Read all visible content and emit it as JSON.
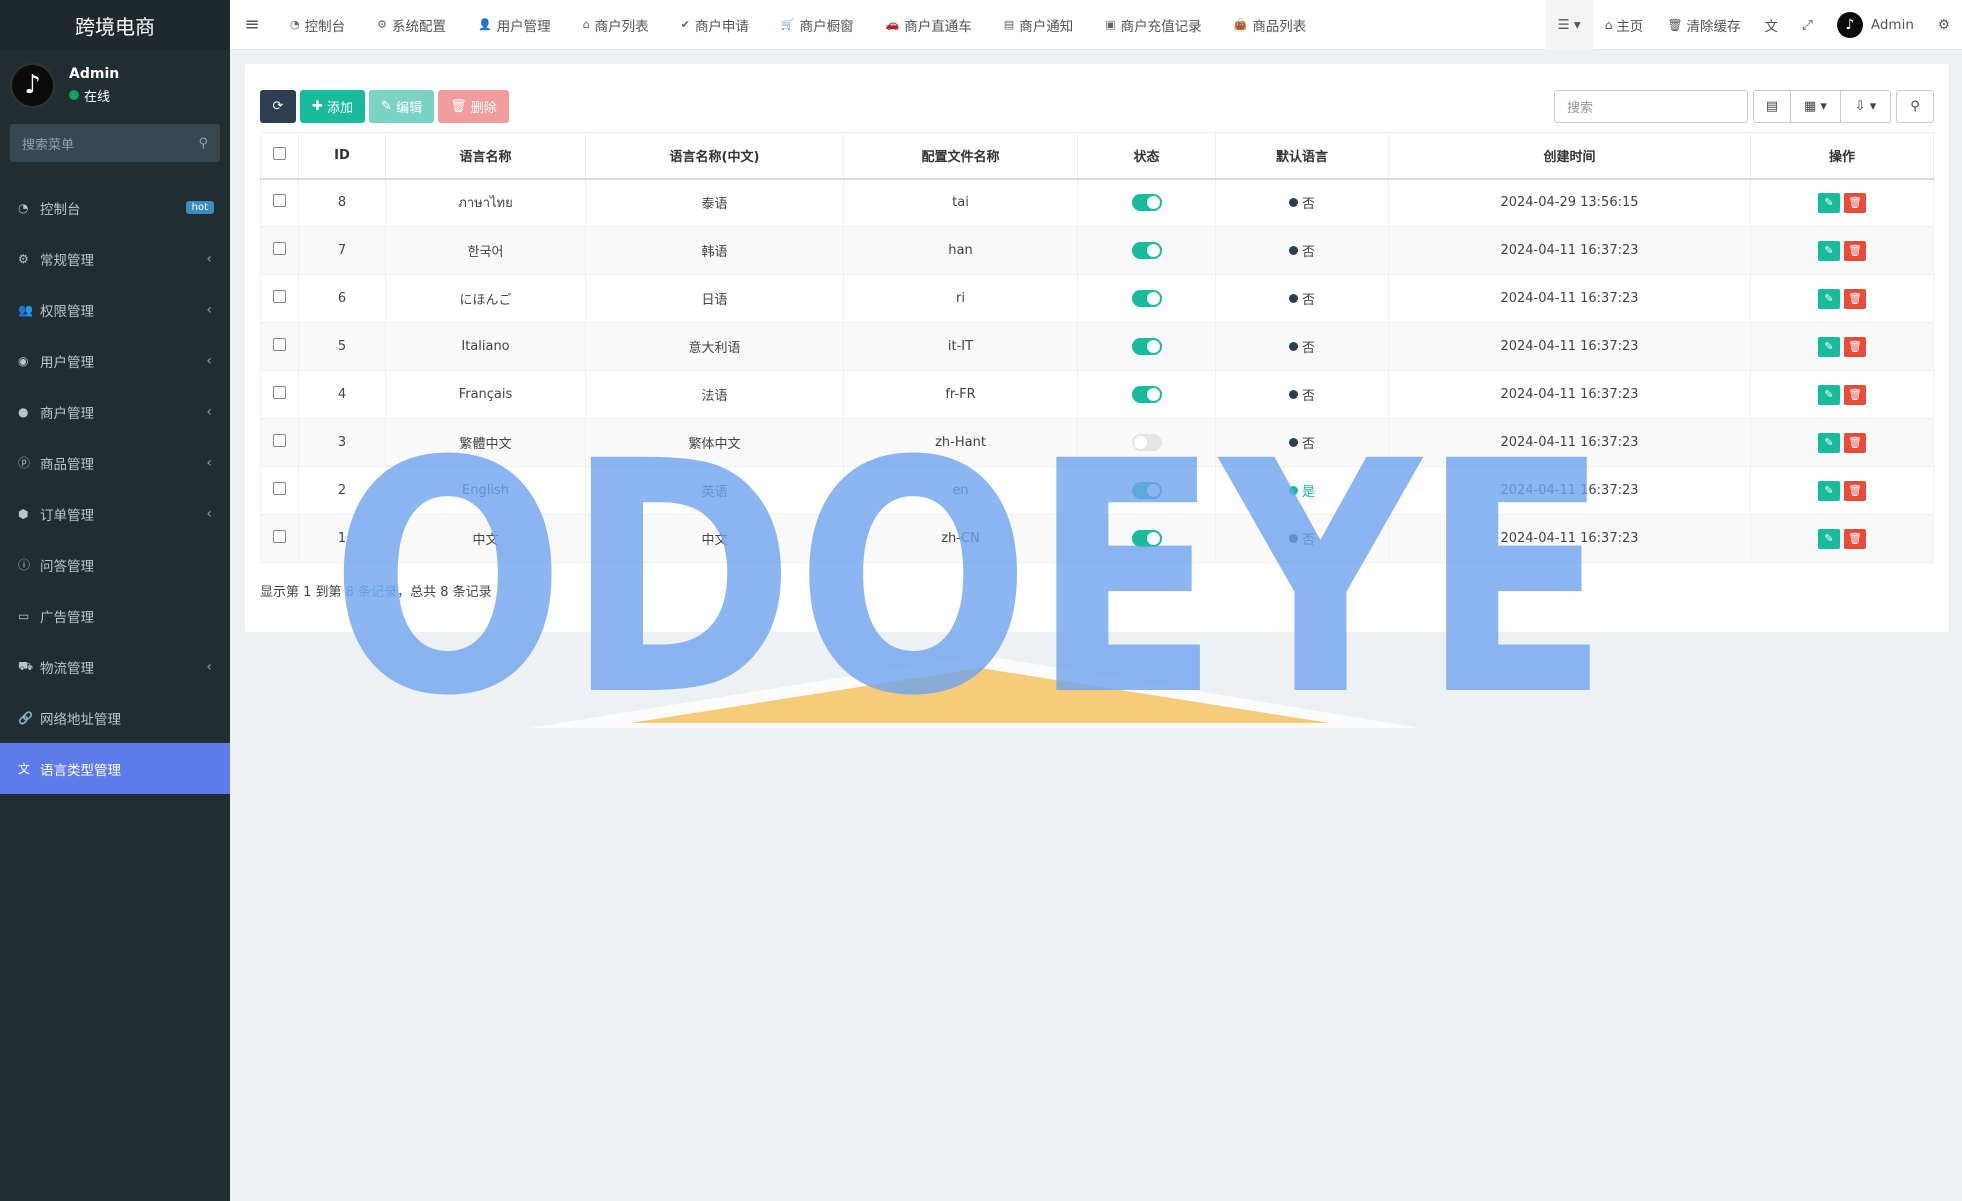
{
  "brand": "跨境电商",
  "user": {
    "name": "Admin",
    "status": "在线"
  },
  "sidebar": {
    "search_placeholder": "搜索菜单",
    "items": [
      {
        "label": "控制台",
        "icon": "dashboard-icon",
        "badge": "hot"
      },
      {
        "label": "常规管理",
        "icon": "cogs-icon"
      },
      {
        "label": "权限管理",
        "icon": "users-icon"
      },
      {
        "label": "用户管理",
        "icon": "user-circle-icon"
      },
      {
        "label": "商户管理",
        "icon": "apple-icon"
      },
      {
        "label": "商品管理",
        "icon": "product-icon"
      },
      {
        "label": "订单管理",
        "icon": "cube-icon"
      },
      {
        "label": "问答管理",
        "icon": "question-icon"
      },
      {
        "label": "广告管理",
        "icon": "card-icon"
      },
      {
        "label": "物流管理",
        "icon": "truck-icon"
      },
      {
        "label": "网络地址管理",
        "icon": "link-icon"
      },
      {
        "label": "语言类型管理",
        "icon": "language-icon",
        "active": true
      }
    ]
  },
  "topbar": {
    "tabs": [
      {
        "label": "控制台",
        "icon": "dashboard-icon"
      },
      {
        "label": "系统配置",
        "icon": "gear-icon"
      },
      {
        "label": "用户管理",
        "icon": "user-icon"
      },
      {
        "label": "商户列表",
        "icon": "home-icon"
      },
      {
        "label": "商户申请",
        "icon": "check-circle-icon"
      },
      {
        "label": "商户橱窗",
        "icon": "cart-icon"
      },
      {
        "label": "商户直通车",
        "icon": "car-icon"
      },
      {
        "label": "商户通知",
        "icon": "calendar-icon"
      },
      {
        "label": "商户充值记录",
        "icon": "money-icon"
      },
      {
        "label": "商品列表",
        "icon": "shopping-bag-icon"
      }
    ],
    "right": {
      "home": "主页",
      "clear_cache": "清除缓存",
      "admin": "Admin"
    }
  },
  "toolbar": {
    "add": "添加",
    "edit": "编辑",
    "delete": "删除",
    "search_placeholder": "搜索"
  },
  "table": {
    "headers": [
      "ID",
      "语言名称",
      "语言名称(中文)",
      "配置文件名称",
      "状态",
      "默认语言",
      "创建时间",
      "操作"
    ],
    "rows": [
      {
        "id": "8",
        "name": "ภาษาไทย",
        "name_cn": "泰语",
        "file": "tai",
        "status": true,
        "default": "否",
        "created": "2024-04-29 13:56:15"
      },
      {
        "id": "7",
        "name": "한국어",
        "name_cn": "韩语",
        "file": "han",
        "status": true,
        "default": "否",
        "created": "2024-04-11 16:37:23"
      },
      {
        "id": "6",
        "name": "にほんご",
        "name_cn": "日语",
        "file": "ri",
        "status": true,
        "default": "否",
        "created": "2024-04-11 16:37:23"
      },
      {
        "id": "5",
        "name": "Italiano",
        "name_cn": "意大利语",
        "file": "it-IT",
        "status": true,
        "default": "否",
        "created": "2024-04-11 16:37:23"
      },
      {
        "id": "4",
        "name": "Français",
        "name_cn": "法语",
        "file": "fr-FR",
        "status": true,
        "default": "否",
        "created": "2024-04-11 16:37:23"
      },
      {
        "id": "3",
        "name": "繁體中文",
        "name_cn": "繁体中文",
        "file": "zh-Hant",
        "status": false,
        "default": "否",
        "created": "2024-04-11 16:37:23"
      },
      {
        "id": "2",
        "name": "English",
        "name_cn": "英语",
        "file": "en",
        "status": true,
        "default": "是",
        "created": "2024-04-11 16:37:23"
      },
      {
        "id": "1",
        "name": "中文",
        "name_cn": "中文",
        "file": "zh-CN",
        "status": true,
        "default": "否",
        "created": "2024-04-11 16:37:23"
      }
    ]
  },
  "footer": {
    "prefix": "显示第 1 到第 ",
    "count": "8 条记录",
    "suffix": "，总共 8 条记录"
  },
  "watermark": "ODOEYE",
  "colors": {
    "sidebar_bg": "#222d32",
    "active": "#5d7cea",
    "success": "#18bc9c",
    "danger": "#e74c3c",
    "watermark": "#6fa4ee",
    "watermark_roof": "#f5c56a"
  }
}
